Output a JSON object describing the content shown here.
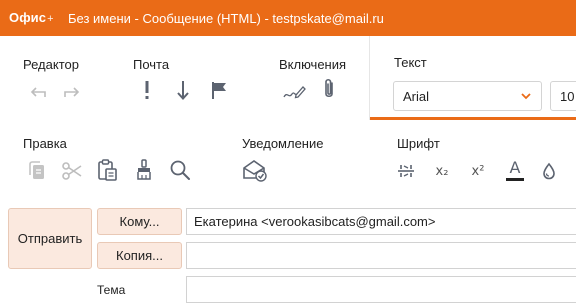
{
  "titlebar": {
    "app_name": "Офис",
    "app_suffix": "+",
    "window_title": "Без имени - Сообщение (HTML) - testpskate@mail.ru",
    "color": "#ea6b17"
  },
  "ribbon": {
    "groups": {
      "editor": "Редактор",
      "mail": "Почта",
      "attachments": "Включения",
      "text": "Текст",
      "edit": "Правка",
      "notification": "Уведомление",
      "font": "Шрифт"
    },
    "icons": {
      "undo": "undo-icon",
      "redo": "redo-icon",
      "importance": "exclamation-icon",
      "low_priority": "down-arrow-icon",
      "flag": "flag-icon",
      "signature": "signature-pen-icon",
      "attach": "paperclip-icon",
      "copy": "copy-icon",
      "cut": "scissors-icon",
      "paste": "clipboard-icon",
      "format_painter": "format-painter-icon",
      "find": "search-icon",
      "read_receipt": "envelope-check-icon",
      "strikethrough": "strikethrough-icon",
      "subscript": "subscript-icon",
      "superscript": "superscript-icon",
      "font_color": "font-color-icon",
      "highlight": "drop-icon"
    },
    "font_family": "Arial",
    "font_size": "10",
    "subscript_label": "x₂",
    "superscript_label": "x²",
    "font_color_label": "A",
    "accent": "#ea6b17"
  },
  "compose": {
    "send_label": "Отправить",
    "to_label": "Кому...",
    "to_value": "Екатерина <verookasibcats@gmail.com>",
    "cc_label": "Копия...",
    "cc_value": "",
    "subject_label": "Тема",
    "subject_value": ""
  }
}
